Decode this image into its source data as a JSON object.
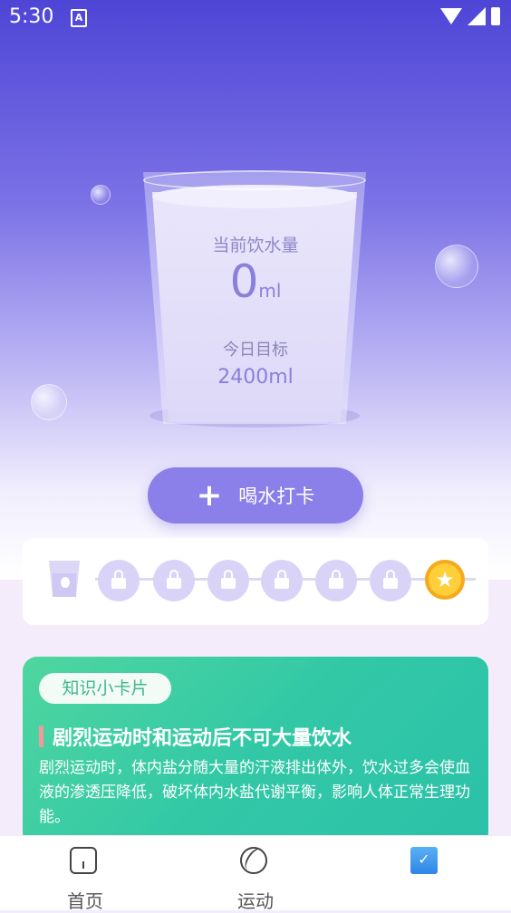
{
  "status_bar": {
    "time": "5:30",
    "notif_icon": "A"
  },
  "glass": {
    "current_label": "当前饮水量",
    "current_value": "0",
    "current_unit": "ml",
    "goal_label": "今日目标",
    "goal_value": "2400ml"
  },
  "drink_button": {
    "icon": "+",
    "label": "喝水打卡"
  },
  "progress": {
    "filled_cups": 0,
    "locked_count": 6,
    "reward_icon": "star-coin-icon"
  },
  "knowledge_card": {
    "tag": "知识小卡片",
    "title": "剧烈运动时和运动后不可大量饮水",
    "body": "剧烈运动时，体内盐分随大量的汗液排出体外，饮水过多会使血液的渗透压降低，破坏体内水盐代谢平衡，影响人体正常生理功能。"
  },
  "tabs": [
    {
      "label": "首页",
      "icon": "home-icon"
    },
    {
      "label": "运动",
      "icon": "ball-icon"
    },
    {
      "label": "",
      "icon": "checklist-icon",
      "active": true
    }
  ],
  "colors": {
    "accent": "#8b7fe9",
    "knowledge": "#32c8a6"
  }
}
